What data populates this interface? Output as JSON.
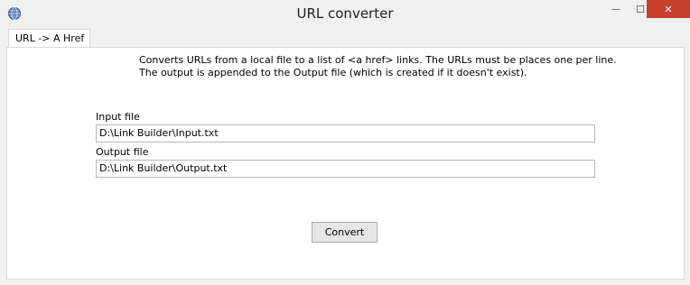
{
  "window": {
    "title": "URL converter",
    "minimize_glyph": "—",
    "maximize_glyph": "☐",
    "close_glyph": "✕",
    "close_color": "#c7412c"
  },
  "tabs": [
    {
      "label": "URL -> A Href",
      "selected": true
    }
  ],
  "main": {
    "description": "Converts URLs from a local file to a list of <a href> links. The URLs must be places one per line.\nThe output is appended to the Output file (which is created if it doesn't exist).",
    "input_label": "Input file",
    "input_value": "D:\\Link Builder\\Input.txt",
    "output_label": "Output file",
    "output_value": "D:\\Link Builder\\Output.txt",
    "convert_label": "Convert"
  }
}
